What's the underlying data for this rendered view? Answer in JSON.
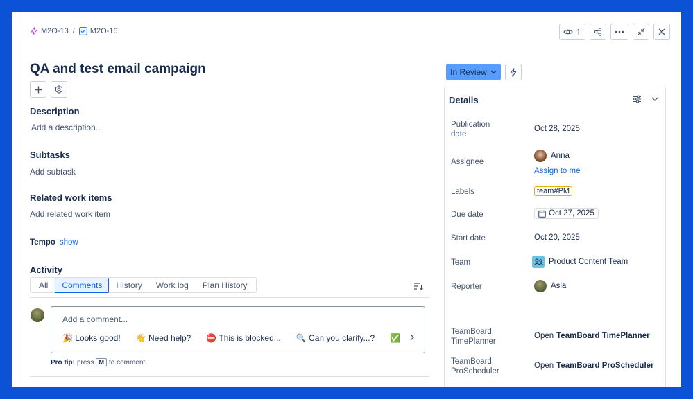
{
  "breadcrumb": {
    "parent_key": "M2O-13",
    "separator": "/",
    "issue_key": "M2O-16"
  },
  "top_actions": {
    "watch_count": "1",
    "icons": [
      "eye-icon",
      "share-icon",
      "more-icon",
      "collapse-icon",
      "close-icon"
    ]
  },
  "issue": {
    "title": "QA and test email campaign"
  },
  "sections": {
    "description_h": "Description",
    "description_ph": "Add a description...",
    "subtasks_h": "Subtasks",
    "subtasks_ph": "Add subtask",
    "related_h": "Related work items",
    "related_ph": "Add related work item",
    "tempo_label": "Tempo",
    "tempo_link": "show",
    "activity_h": "Activity"
  },
  "activity_tabs": [
    {
      "label": "All",
      "active": false
    },
    {
      "label": "Comments",
      "active": true
    },
    {
      "label": "History",
      "active": false
    },
    {
      "label": "Work log",
      "active": false
    },
    {
      "label": "Plan History",
      "active": false
    }
  ],
  "comment": {
    "placeholder": "Add a comment...",
    "quick_replies": [
      "🎉 Looks good!",
      "👋 Need help?",
      "⛔ This is blocked...",
      "🔍 Can you clarify...?",
      "✅ This"
    ],
    "pro_tip_label": "Pro tip:",
    "pro_tip_press": "press",
    "pro_tip_key": "M",
    "pro_tip_suffix": "to comment"
  },
  "status": {
    "label": "In Review"
  },
  "details": {
    "header": "Details",
    "publication_date_label": "Publication date",
    "publication_date": "Oct 28, 2025",
    "assignee_label": "Assignee",
    "assignee": "Anna",
    "assign_to_me": "Assign to me",
    "labels_label": "Labels",
    "label_value": "team#PM",
    "due_date_label": "Due date",
    "due_date": "Oct 27, 2025",
    "start_date_label": "Start date",
    "start_date": "Oct 20, 2025",
    "team_label": "Team",
    "team": "Product Content Team",
    "reporter_label": "Reporter",
    "reporter": "Asia",
    "timeplanner_label": "TeamBoard TimePlanner",
    "timeplanner_open": "Open",
    "timeplanner_name": "TeamBoard TimePlanner",
    "proscheduler_label": "TeamBoard ProScheduler",
    "proscheduler_open": "Open",
    "proscheduler_name": "TeamBoard ProScheduler"
  },
  "colors": {
    "frame": "#0b52d6",
    "status_bg": "#579dff",
    "link": "#0c66e4",
    "label_border": "#e2b203"
  }
}
